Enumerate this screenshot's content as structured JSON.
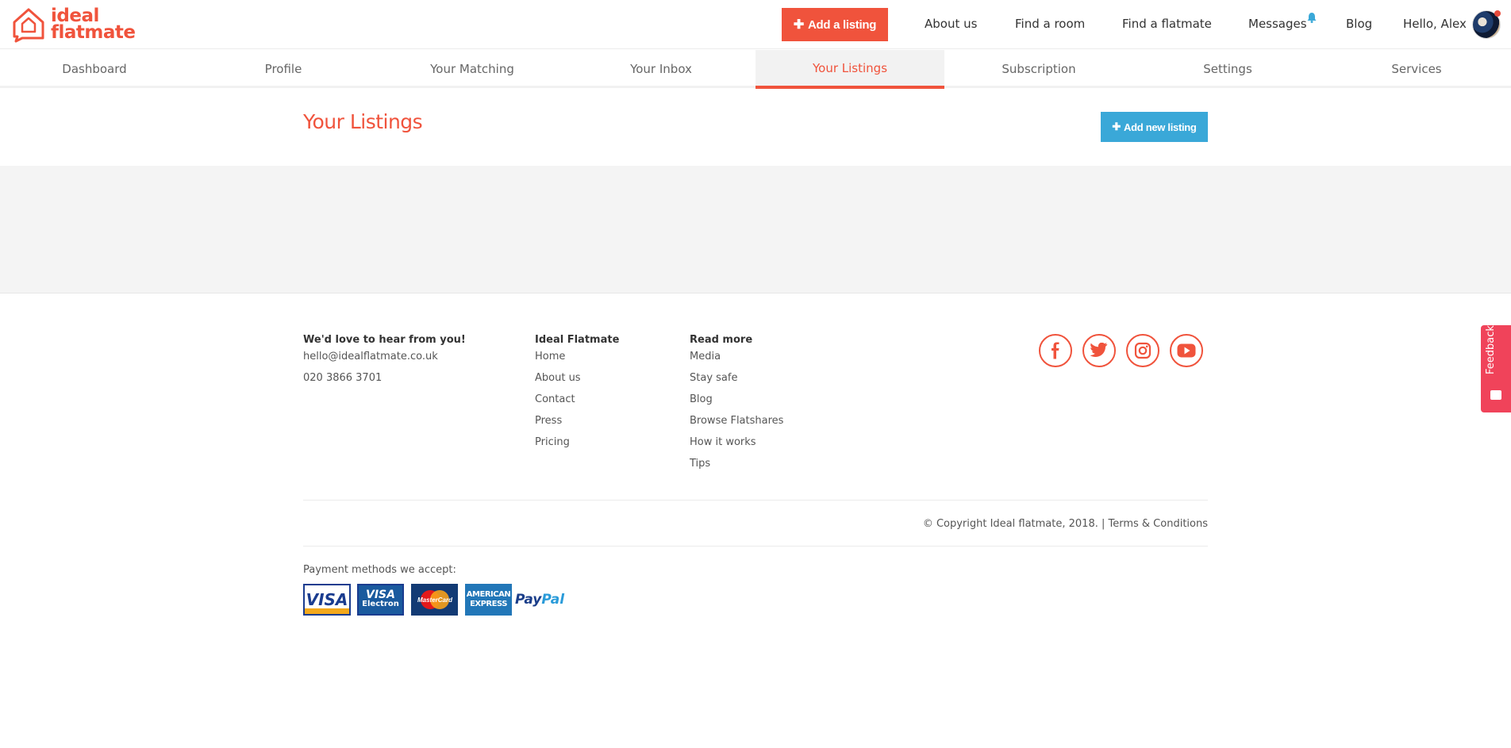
{
  "brand": {
    "logo_line1": "ideal",
    "logo_line2": "flatmate",
    "accent": "#f0533c",
    "secondary": "#3aa8d8"
  },
  "topnav": {
    "add_listing_label": "Add a listing",
    "links": [
      "About us",
      "Find a room",
      "Find a flatmate",
      "Messages",
      "Blog"
    ],
    "user_greeting": "Hello, Alex"
  },
  "subnav": {
    "tabs": [
      "Dashboard",
      "Profile",
      "Your Matching",
      "Your Inbox",
      "Your Listings",
      "Subscription",
      "Settings",
      "Services"
    ],
    "active_tab": "Your Listings"
  },
  "main": {
    "title": "Your Listings",
    "add_new_label": "Add new listing"
  },
  "footer": {
    "contact": {
      "heading": "We'd love to hear from you!",
      "email": "hello@idealflatmate.co.uk",
      "phone": "020 3866 3701"
    },
    "ideal_flatmate": {
      "heading": "Ideal Flatmate",
      "links": [
        "Home",
        "About us",
        "Contact",
        "Press",
        "Pricing"
      ]
    },
    "read_more": {
      "heading": "Read more",
      "links": [
        "Media",
        "Stay safe",
        "Blog",
        "Browse Flatshares",
        "How it works",
        "Tips"
      ]
    },
    "social": [
      "facebook-icon",
      "twitter-icon",
      "instagram-icon",
      "youtube-icon"
    ],
    "copyright": "© Copyright Ideal flatmate, 2018. | Terms & Conditions",
    "payment_label": "Payment methods we accept:",
    "payment_methods": {
      "visa": "VISA",
      "electron_top": "VISA",
      "electron_bottom": "Electron",
      "mastercard": "MasterCard",
      "amex_top": "AMERICAN",
      "amex_bottom": "EXPRESS",
      "paypal_a": "Pay",
      "paypal_b": "Pal"
    }
  },
  "feedback": {
    "label": "Feedback",
    "color": "#f0435a"
  }
}
